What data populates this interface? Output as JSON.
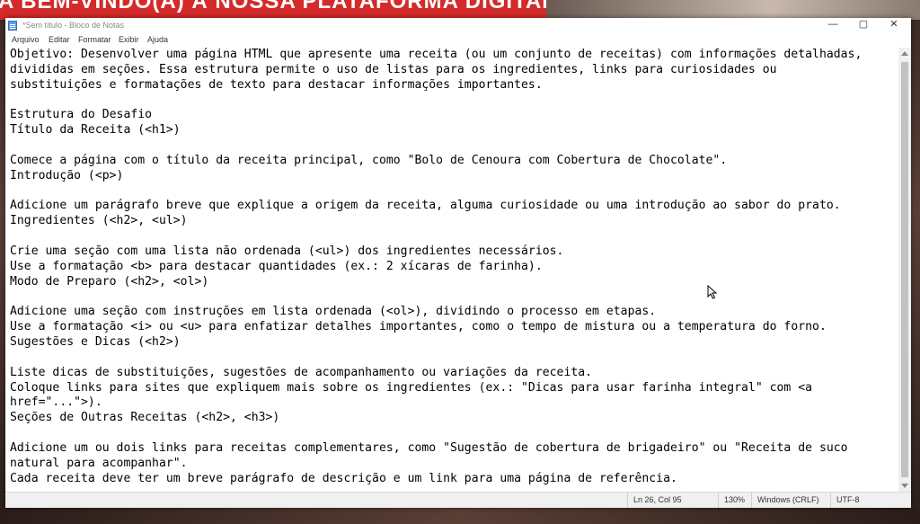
{
  "background": {
    "banner_text": "A BEM-VINDO(A) À NOSSA PLATAFORMA DIGITAL!"
  },
  "window": {
    "title": "*Sem título - Bloco de Notas",
    "controls": {
      "minimize": "—",
      "maximize": "▢",
      "close": "✕"
    }
  },
  "menu": {
    "items": [
      "Arquivo",
      "Editar",
      "Formatar",
      "Exibir",
      "Ajuda"
    ]
  },
  "editor": {
    "content": "Objetivo: Desenvolver uma página HTML que apresente uma receita (ou um conjunto de receitas) com informações detalhadas,\ndivididas em seções. Essa estrutura permite o uso de listas para os ingredientes, links para curiosidades ou\nsubstituições e formatações de texto para destacar informações importantes.\n\nEstrutura do Desafio\nTítulo da Receita (<h1>)\n\nComece a página com o título da receita principal, como \"Bolo de Cenoura com Cobertura de Chocolate\".\nIntrodução (<p>)\n\nAdicione um parágrafo breve que explique a origem da receita, alguma curiosidade ou uma introdução ao sabor do prato.\nIngredientes (<h2>, <ul>)\n\nCrie uma seção com uma lista não ordenada (<ul>) dos ingredientes necessários.\nUse a formatação <b> para destacar quantidades (ex.: 2 xícaras de farinha).\nModo de Preparo (<h2>, <ol>)\n\nAdicione uma seção com instruções em lista ordenada (<ol>), dividindo o processo em etapas.\nUse a formatação <i> ou <u> para enfatizar detalhes importantes, como o tempo de mistura ou a temperatura do forno.\nSugestões e Dicas (<h2>)\n\nListe dicas de substituições, sugestões de acompanhamento ou variações da receita.\nColoque links para sites que expliquem mais sobre os ingredientes (ex.: \"Dicas para usar farinha integral\" com <a\nhref=\"...\">).\nSeções de Outras Receitas (<h2>, <h3>)\n\nAdicione um ou dois links para receitas complementares, como \"Sugestão de cobertura de brigadeiro\" ou \"Receita de suco\nnatural para acompanhar\".\nCada receita deve ter um breve parágrafo de descrição e um link para uma página de referência."
  },
  "status": {
    "position": "Ln 26, Col 95",
    "zoom": "130%",
    "line_ending": "Windows (CRLF)",
    "encoding": "UTF-8"
  }
}
